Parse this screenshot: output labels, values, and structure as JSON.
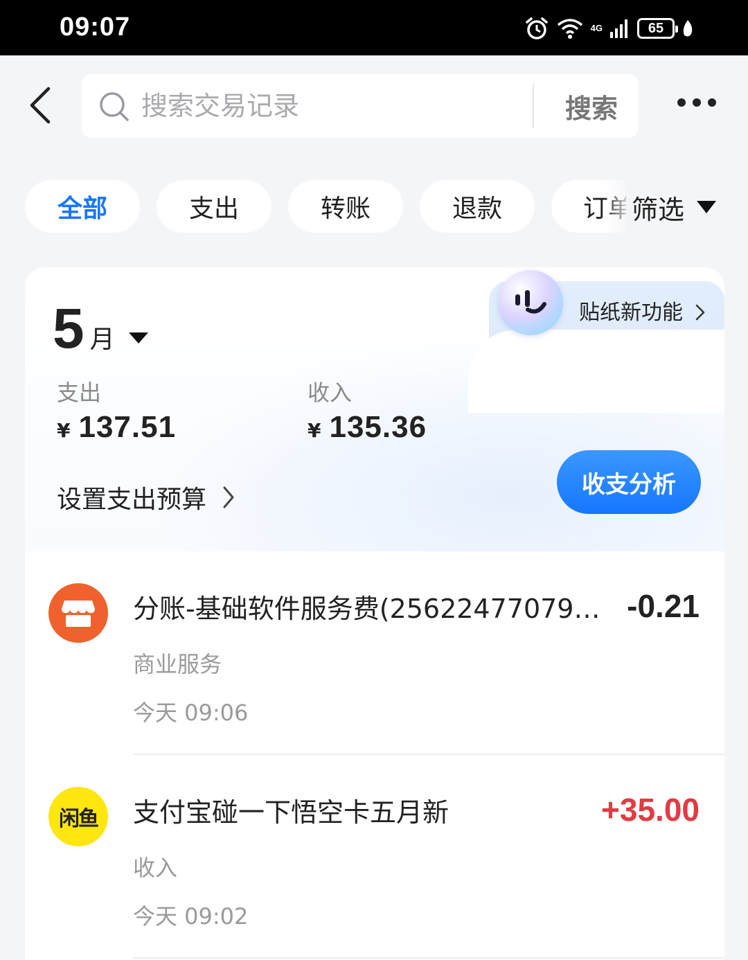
{
  "status_bar": {
    "time": "09:07",
    "network": "4G",
    "battery": "65",
    "icons": [
      "alarm-icon",
      "wifi-icon",
      "signal-icon",
      "battery-icon",
      "leaf-icon"
    ]
  },
  "header": {
    "search_placeholder": "搜索交易记录",
    "search_button": "搜索"
  },
  "filters": {
    "chips": [
      "全部",
      "支出",
      "转账",
      "退款",
      "订单"
    ],
    "active_index": 0,
    "filter_button": "筛选"
  },
  "summary": {
    "sticker_label": "贴纸新功能",
    "month_num": "5",
    "month_unit": "月",
    "expense_label": "支出",
    "expense_currency": "¥",
    "expense_amount": "137.51",
    "income_label": "收入",
    "income_currency": "¥",
    "income_amount": "135.36",
    "budget_link": "设置支出预算",
    "analysis_button": "收支分析"
  },
  "transactions": [
    {
      "title": "分账-基础软件服务费(256224770796...",
      "amount": "-0.21",
      "category": "商业服务",
      "time": "今天 09:06",
      "icon": "shop-icon",
      "icon_color": "#f0622d",
      "amount_color": "#222222"
    },
    {
      "title": "支付宝碰一下悟空卡五月新",
      "amount": "+35.00",
      "category": "收入",
      "time": "今天 09:02",
      "icon": "xianyu-logo",
      "icon_label": "闲鱼",
      "icon_color": "#ffe60f",
      "amount_color": "#e23b41"
    }
  ],
  "colors": {
    "accent": "#1677ff",
    "background": "#f4f5f7",
    "income_red": "#e23b41"
  }
}
